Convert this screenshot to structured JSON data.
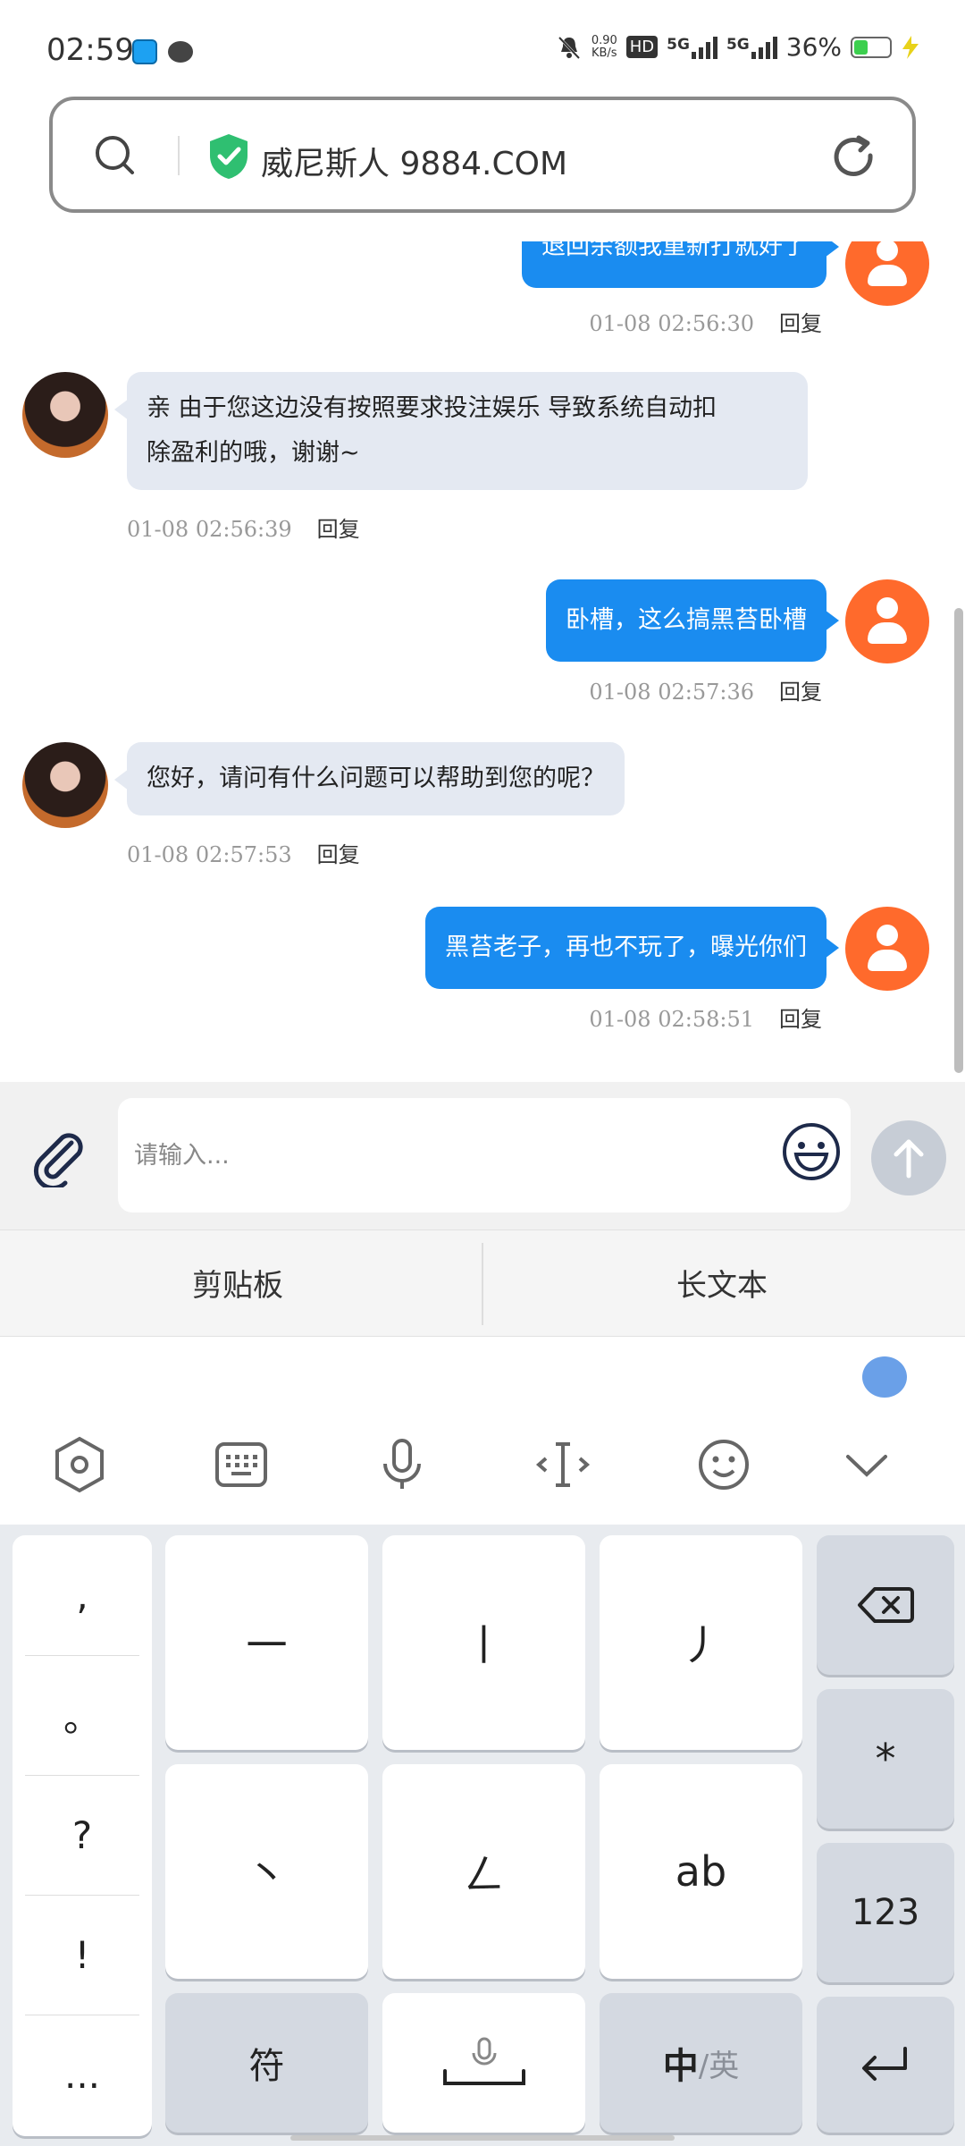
{
  "status_bar": {
    "time": "02:59",
    "net_speed_value": "0.90",
    "net_speed_unit": "KB/s",
    "hd_label": "HD",
    "net1": "5G",
    "net2": "5G",
    "battery": "36%",
    "battery_level": 0.36
  },
  "address_bar": {
    "site_title": "威尼斯人 9884.COM",
    "secure_icon_color": "#2fbf71"
  },
  "chat": {
    "messages": [
      {
        "side": "right",
        "text": "退回余额我重新打就好了",
        "time": "01-08 02:56:30",
        "reply": "回复"
      },
      {
        "side": "left",
        "text_line1": "亲 由于您这边没有按照要求投注娱乐  导致系统自动扣",
        "text_line2": "除盈利的哦，谢谢~",
        "time": "01-08 02:56:39",
        "reply": "回复"
      },
      {
        "side": "right",
        "text": "卧槽，这么搞黑苔卧槽",
        "time": "01-08 02:57:36",
        "reply": "回复"
      },
      {
        "side": "left",
        "text": "您好，请问有什么问题可以帮助到您的呢？",
        "time": "01-08 02:57:53",
        "reply": "回复"
      },
      {
        "side": "right",
        "text": "黑苔老子，再也不玩了，曝光你们",
        "time": "01-08 02:58:51",
        "reply": "回复"
      }
    ]
  },
  "input": {
    "placeholder": "请输入..."
  },
  "keyboard": {
    "clipboard_label": "剪贴板",
    "long_text_label": "长文本",
    "punct": [
      ",",
      "。",
      "?",
      "!",
      "..."
    ],
    "strokes": [
      "一",
      "丨",
      "丿",
      "丶",
      "ㄥ",
      "ab"
    ],
    "symbols_label": "符",
    "lang_main": "中",
    "lang_alt": "/英",
    "star_label": "*",
    "num_label": "123"
  },
  "colors": {
    "accent_blue": "#1a8cf0",
    "user_avatar": "#ff6a2c",
    "agent_bubble": "#e4e9f2"
  }
}
